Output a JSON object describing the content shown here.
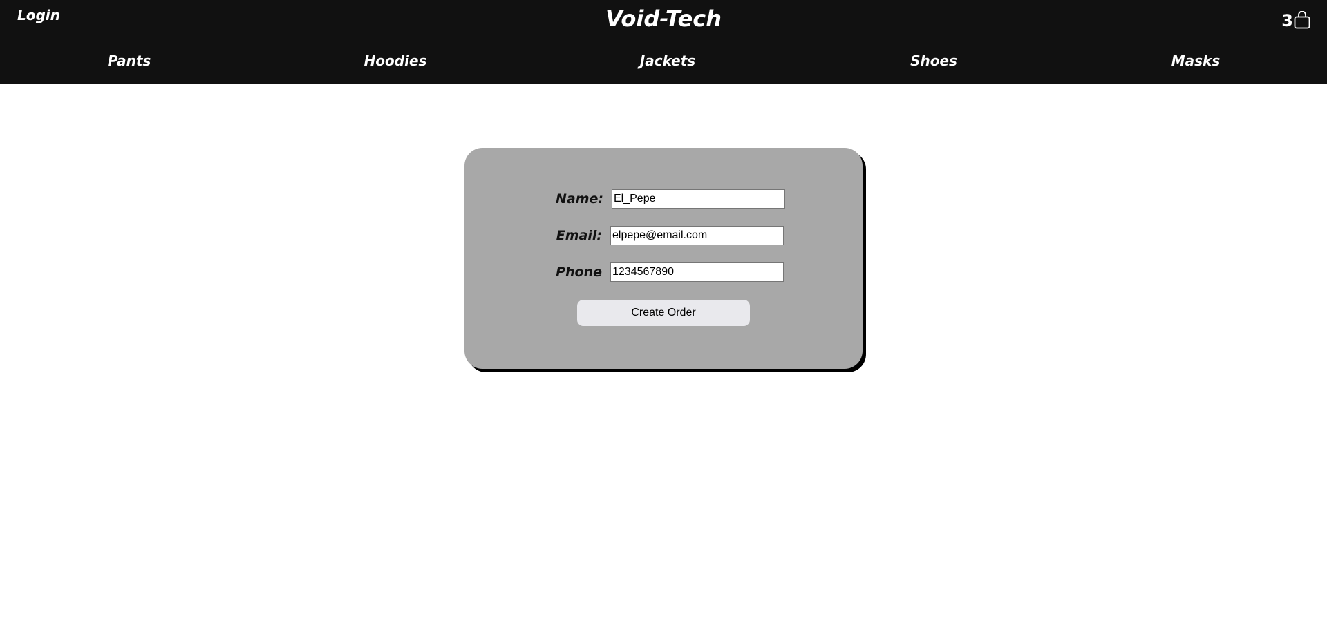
{
  "header": {
    "login_label": "Login",
    "brand": "Void-Tech",
    "cart_count": "3",
    "cart_icon": "shopping-bag-icon"
  },
  "nav": {
    "items": [
      {
        "label": "Pants"
      },
      {
        "label": "Hoodies"
      },
      {
        "label": "Jackets"
      },
      {
        "label": "Shoes"
      },
      {
        "label": "Masks"
      }
    ]
  },
  "order_form": {
    "name_label": "Name:",
    "name_value": "El_Pepe",
    "email_label": "Email:",
    "email_value": "elpepe@email.com",
    "phone_label": "Phone",
    "phone_value": "1234567890",
    "submit_label": "Create Order"
  },
  "colors": {
    "header_bg": "#111111",
    "card_bg": "#a8a8a8",
    "card_shadow": "#000000",
    "button_bg": "#e9e9ed"
  }
}
